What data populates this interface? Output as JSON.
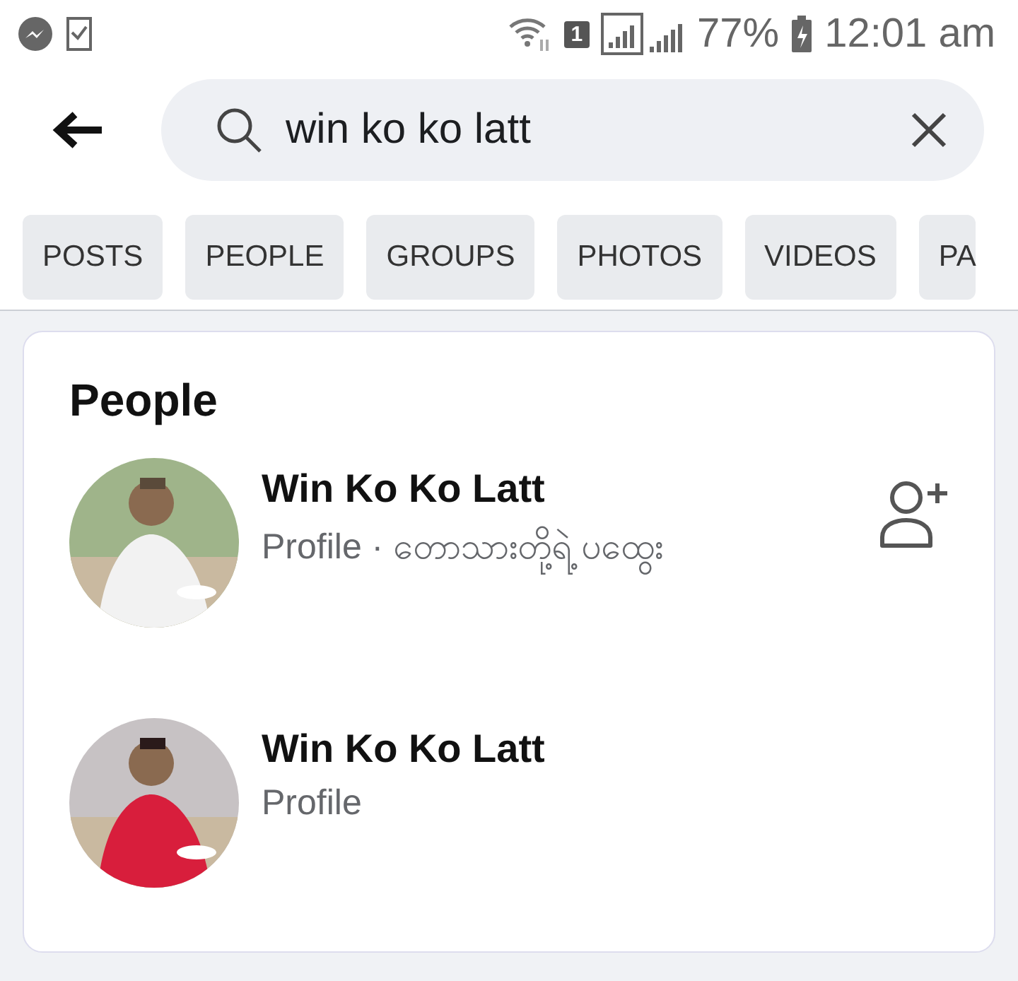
{
  "status_bar": {
    "sim": "1",
    "battery": "77%",
    "time": "12:01 am"
  },
  "search": {
    "value": "win ko ko latt"
  },
  "filters": [
    {
      "label": "POSTS",
      "selected": false
    },
    {
      "label": "PEOPLE",
      "selected": false
    },
    {
      "label": "GROUPS",
      "selected": false
    },
    {
      "label": "PHOTOS",
      "selected": false
    },
    {
      "label": "VIDEOS",
      "selected": false
    },
    {
      "label": "PA",
      "selected": false
    }
  ],
  "people": {
    "title": "People",
    "results": [
      {
        "name": "Win Ko Ko Latt",
        "subtitle": "Profile · တောသားတို့ရဲ့ ပထွေး",
        "add_friend": true
      },
      {
        "name": "Win Ko Ko Latt",
        "subtitle": "Profile",
        "add_friend": false
      }
    ]
  }
}
